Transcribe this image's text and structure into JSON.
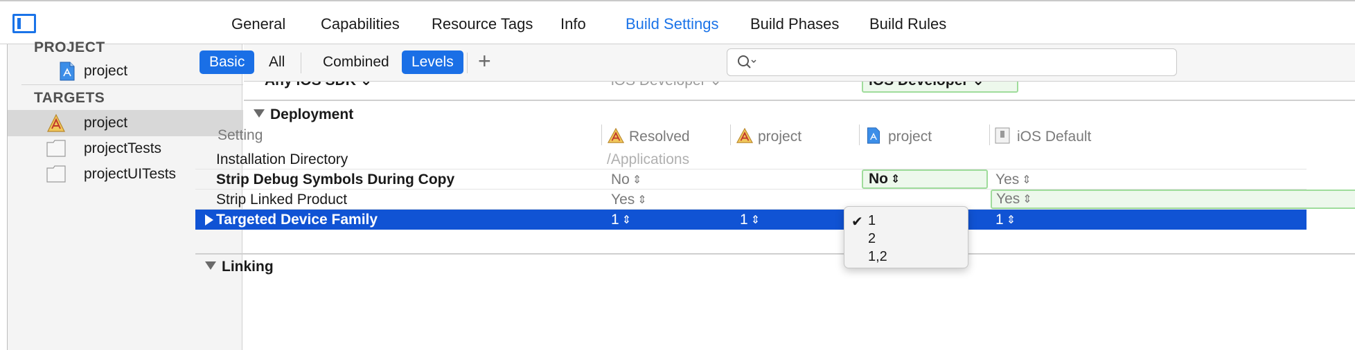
{
  "tabs": [
    "General",
    "Capabilities",
    "Resource Tags",
    "Info",
    "Build Settings",
    "Build Phases",
    "Build Rules"
  ],
  "active_tab": "Build Settings",
  "sidebar": {
    "project_header": "PROJECT",
    "project_item": "project",
    "targets_header": "TARGETS",
    "targets": [
      "project",
      "projectTests",
      "projectUITests"
    ]
  },
  "filters": {
    "basic": "Basic",
    "all": "All",
    "combined": "Combined",
    "levels": "Levels",
    "add": "+"
  },
  "search": {
    "placeholder": ""
  },
  "cut_row": {
    "setting": "Any iOS SDK ⌄",
    "resolved": "iOS Developer ⌄",
    "project": "iOS Developer ⌄"
  },
  "deployment": {
    "title": "Deployment",
    "columns": {
      "setting": "Setting",
      "resolved": "Resolved",
      "target": "project",
      "project": "project",
      "ios_default": "iOS Default"
    },
    "rows": [
      {
        "name": "Installation Directory",
        "resolved": "/Applications",
        "target": "",
        "project": "",
        "ios_default": ""
      },
      {
        "name": "Strip Debug Symbols During Copy",
        "resolved": "No",
        "target": "",
        "project": "No",
        "ios_default": "Yes"
      },
      {
        "name": "Strip Linked Product",
        "resolved": "Yes",
        "target": "",
        "project": "",
        "ios_default": "Yes"
      },
      {
        "name": "Targeted Device Family",
        "resolved": "1",
        "target": "1",
        "project": "",
        "ios_default": "1"
      }
    ]
  },
  "popup_menu": {
    "options": [
      "1",
      "2",
      "1,2"
    ],
    "selected": "1"
  },
  "linking": {
    "title": "Linking"
  },
  "colors": {
    "accent": "#1a73e8",
    "selection": "#1053d4",
    "green_box": "#edf8ec"
  }
}
